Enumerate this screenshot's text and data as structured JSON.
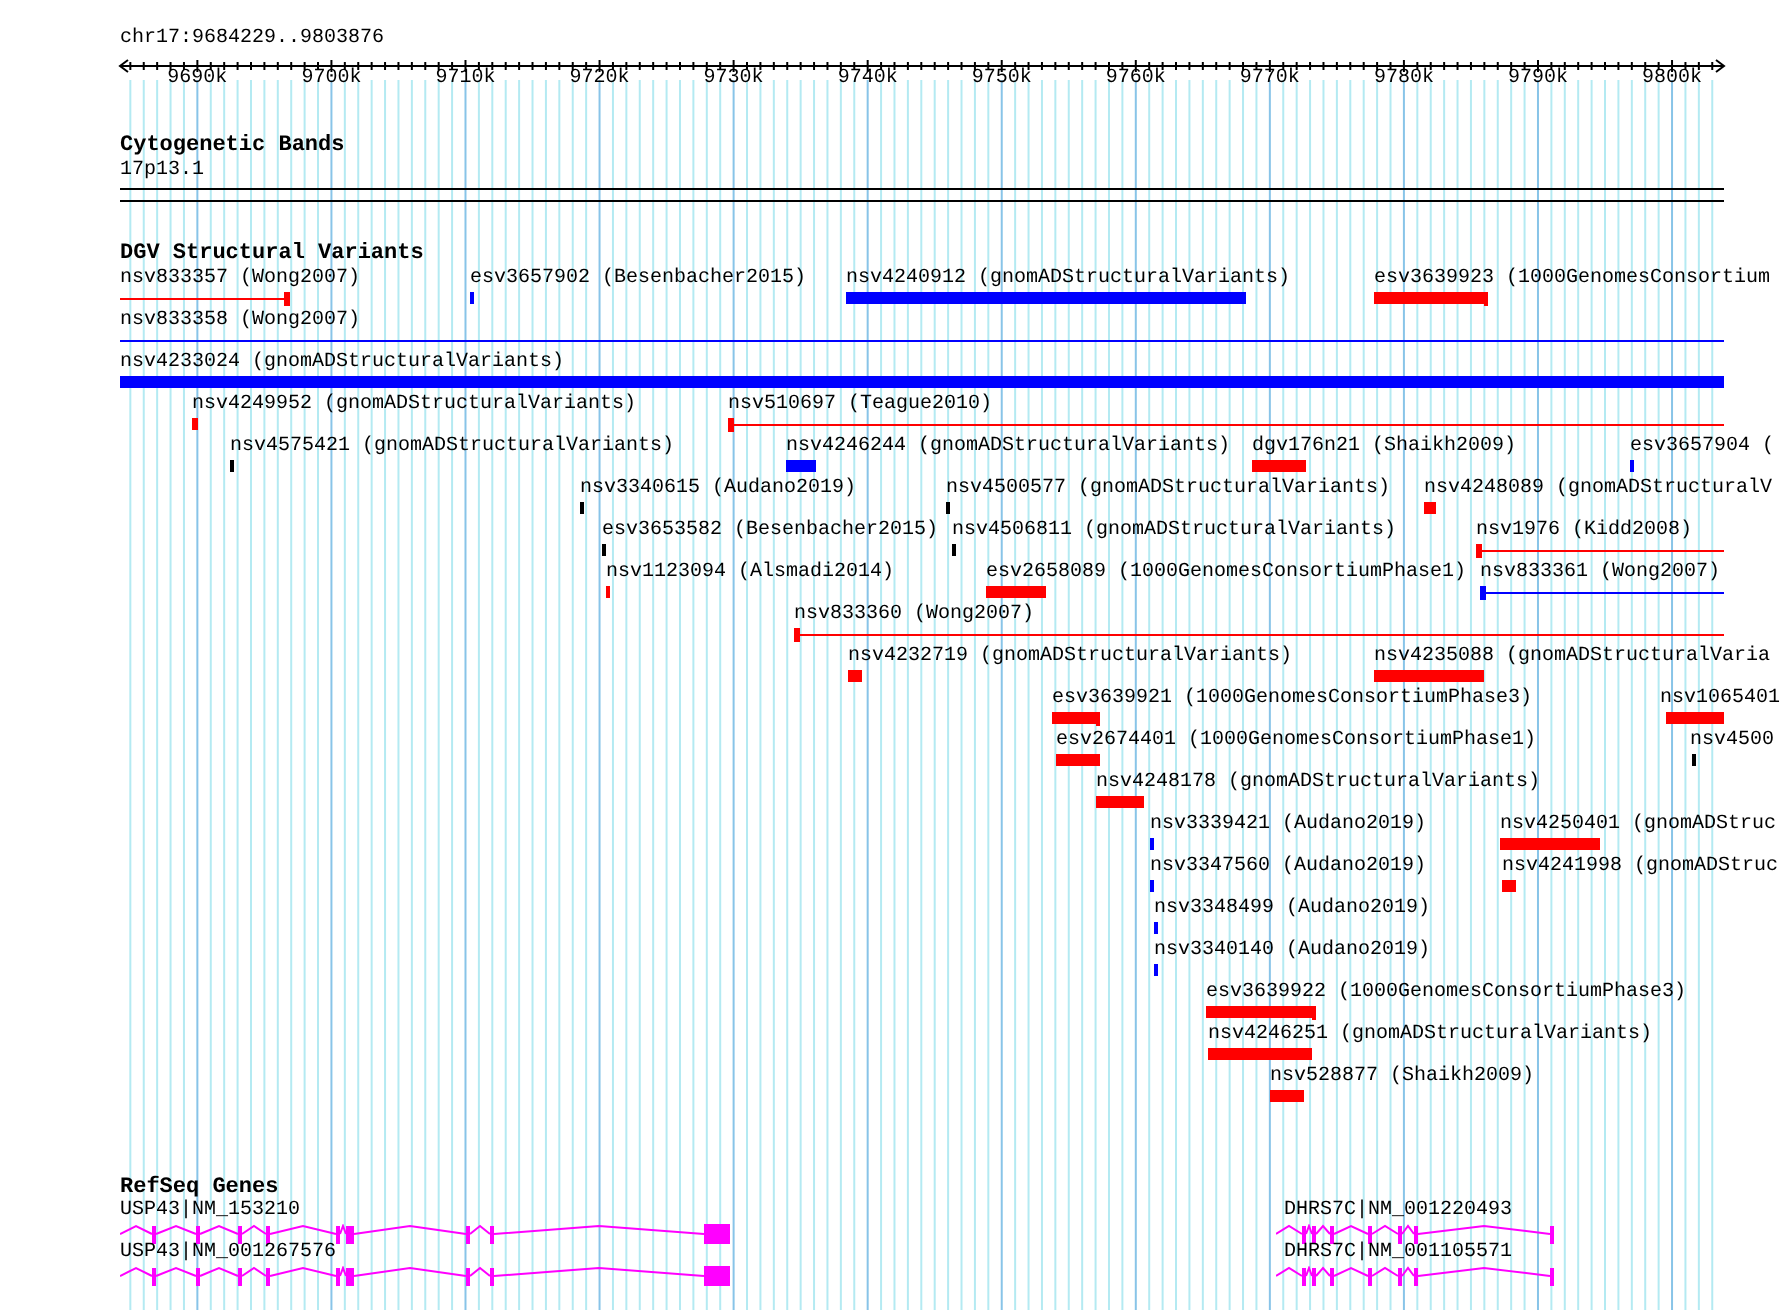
{
  "ruler": {
    "location": "chr17:9684229..9803876",
    "ticks": [
      "9690k",
      "9700k",
      "9710k",
      "9720k",
      "9730k",
      "9740k",
      "9750k",
      "9760k",
      "9770k",
      "9780k",
      "9790k",
      "9800k"
    ]
  },
  "cytogenetic_bands": {
    "title": "Cytogenetic Bands",
    "band": "17p13.1"
  },
  "dgv": {
    "title": "DGV Structural Variants",
    "features": [
      {
        "label": "nsv833357 (Wong2007)",
        "color": "#ff0000",
        "kind": "line"
      },
      {
        "label": "esv3657902 (Besenbacher2015)",
        "color": "#0000ff",
        "kind": "bar"
      },
      {
        "label": "nsv4240912 (gnomADStructuralVariants)",
        "color": "#0000ff",
        "kind": "bar"
      },
      {
        "label": "esv3639923 (1000GenomesConsortium",
        "color": "#ff0000",
        "kind": "bar"
      },
      {
        "label": "nsv833358 (Wong2007)",
        "color": "#0000ff",
        "kind": "line"
      },
      {
        "label": "nsv4233024 (gnomADStructuralVariants)",
        "color": "#0000ff",
        "kind": "bar"
      },
      {
        "label": "nsv4249952 (gnomADStructuralVariants)",
        "color": "#ff0000",
        "kind": "bar"
      },
      {
        "label": "nsv510697 (Teague2010)",
        "color": "#ff0000",
        "kind": "line"
      },
      {
        "label": "nsv4575421 (gnomADStructuralVariants)",
        "color": "#000000",
        "kind": "bar"
      },
      {
        "label": "nsv4246244 (gnomADStructuralVariants)",
        "color": "#0000ff",
        "kind": "bar"
      },
      {
        "label": "dgv176n21 (Shaikh2009)",
        "color": "#ff0000",
        "kind": "bar"
      },
      {
        "label": "esv3657904 (",
        "color": "#0000ff",
        "kind": "bar"
      },
      {
        "label": "nsv3340615 (Audano2019)",
        "color": "#000000",
        "kind": "bar"
      },
      {
        "label": "nsv4500577 (gnomADStructuralVariants)",
        "color": "#000000",
        "kind": "bar"
      },
      {
        "label": "nsv4248089 (gnomADStructuralV",
        "color": "#ff0000",
        "kind": "bar"
      },
      {
        "label": "esv3653582 (Besenbacher2015)",
        "color": "#000000",
        "kind": "bar"
      },
      {
        "label": "nsv4506811 (gnomADStructuralVariants)",
        "color": "#000000",
        "kind": "bar"
      },
      {
        "label": "nsv1976 (Kidd2008)",
        "color": "#ff0000",
        "kind": "line"
      },
      {
        "label": "nsv1123094 (Alsmadi2014)",
        "color": "#ff0000",
        "kind": "bar"
      },
      {
        "label": "esv2658089 (1000GenomesConsortiumPhase1)",
        "color": "#ff0000",
        "kind": "bar"
      },
      {
        "label": "nsv833361 (Wong2007)",
        "color": "#0000ff",
        "kind": "line"
      },
      {
        "label": "nsv833360 (Wong2007)",
        "color": "#ff0000",
        "kind": "line"
      },
      {
        "label": "nsv4232719 (gnomADStructuralVariants)",
        "color": "#ff0000",
        "kind": "bar"
      },
      {
        "label": "nsv4235088 (gnomADStructuralVaria",
        "color": "#ff0000",
        "kind": "bar"
      },
      {
        "label": "esv3639921 (1000GenomesConsortiumPhase3)",
        "color": "#ff0000",
        "kind": "bar"
      },
      {
        "label": "nsv1065401",
        "color": "#ff0000",
        "kind": "bar"
      },
      {
        "label": "esv2674401 (1000GenomesConsortiumPhase1)",
        "color": "#ff0000",
        "kind": "bar"
      },
      {
        "label": "nsv4500",
        "color": "#000000",
        "kind": "bar"
      },
      {
        "label": "nsv4248178 (gnomADStructuralVariants)",
        "color": "#ff0000",
        "kind": "bar"
      },
      {
        "label": "nsv3339421 (Audano2019)",
        "color": "#0000ff",
        "kind": "bar"
      },
      {
        "label": "nsv4250401 (gnomADStruc",
        "color": "#ff0000",
        "kind": "bar"
      },
      {
        "label": "nsv3347560 (Audano2019)",
        "color": "#0000ff",
        "kind": "bar"
      },
      {
        "label": "nsv4241998 (gnomADStruc",
        "color": "#ff0000",
        "kind": "bar"
      },
      {
        "label": "nsv3348499 (Audano2019)",
        "color": "#0000ff",
        "kind": "bar"
      },
      {
        "label": "nsv3340140 (Audano2019)",
        "color": "#0000ff",
        "kind": "bar"
      },
      {
        "label": "esv3639922 (1000GenomesConsortiumPhase3)",
        "color": "#ff0000",
        "kind": "bar"
      },
      {
        "label": "nsv4246251 (gnomADStructuralVariants)",
        "color": "#ff0000",
        "kind": "bar"
      },
      {
        "label": "nsv528877 (Shaikh2009)",
        "color": "#ff0000",
        "kind": "bar"
      }
    ]
  },
  "refseq_genes": {
    "title": "RefSeq Genes",
    "genes": [
      {
        "label": "USP43|NM_153210"
      },
      {
        "label": "USP43|NM_001267576"
      },
      {
        "label": "DHRS7C|NM_001220493"
      },
      {
        "label": "DHRS7C|NM_001105571"
      }
    ]
  }
}
